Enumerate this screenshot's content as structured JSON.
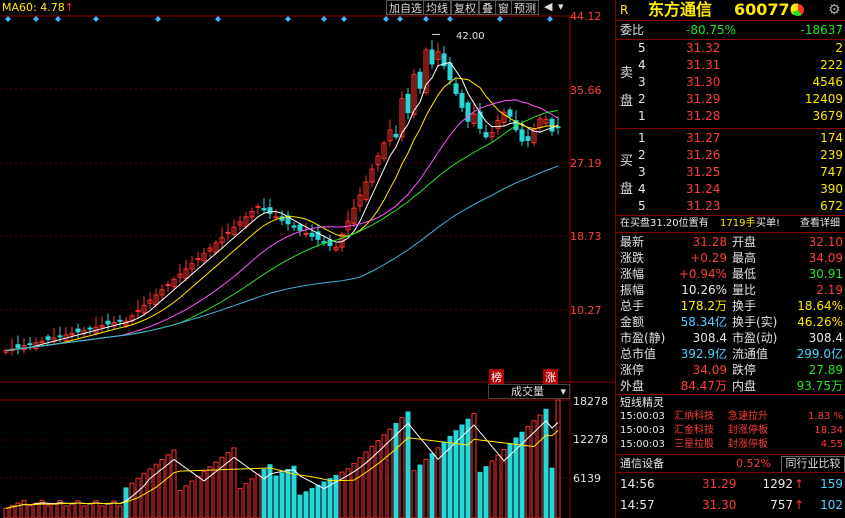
{
  "chart": {
    "ma60_label": "MA60: 4.78",
    "ma60_arrow": "↑",
    "toolbar": [
      "加自选",
      "均线",
      "复权",
      "叠",
      "窗",
      "预测"
    ],
    "price_ticks": [
      "44.12",
      "35.66",
      "27.19",
      "18.73",
      "10.27"
    ],
    "peak_label": "42.00",
    "vol_ticks": [
      "18278",
      "12278",
      "6139"
    ],
    "volume_label": "成交量",
    "tag_left": "榜",
    "tag_right": "涨",
    "colors": {
      "up": "#ff3030",
      "down": "#27d7d7",
      "ma5": "#ffffff",
      "ma10": "#ffea00",
      "ma20": "#ff55ff",
      "ma30": "#27e327",
      "ma60": "#3fb5d9"
    }
  },
  "quote": {
    "logo": "R",
    "name": "东方通信",
    "code": "600776",
    "weibi_label": "委比",
    "weibi_pct": "-80.75%",
    "weibi_val": "-18637",
    "sell_label": [
      "卖",
      "盘"
    ],
    "buy_label": [
      "买",
      "盘"
    ],
    "sell": [
      {
        "n": "5",
        "price": "31.32",
        "vol": "2"
      },
      {
        "n": "4",
        "price": "31.31",
        "vol": "222"
      },
      {
        "n": "3",
        "price": "31.30",
        "vol": "4546"
      },
      {
        "n": "2",
        "price": "31.29",
        "vol": "12409"
      },
      {
        "n": "1",
        "price": "31.28",
        "vol": "3679"
      }
    ],
    "buy": [
      {
        "n": "1",
        "price": "31.27",
        "vol": "174"
      },
      {
        "n": "2",
        "price": "31.26",
        "vol": "239"
      },
      {
        "n": "3",
        "price": "31.25",
        "vol": "747"
      },
      {
        "n": "4",
        "price": "31.24",
        "vol": "390"
      },
      {
        "n": "5",
        "price": "31.23",
        "vol": "672"
      }
    ],
    "notice_pre": "在买盘31.20位置有",
    "notice_vol": "1719手",
    "notice_post": "买单!",
    "notice_link": "查看详细",
    "stats": [
      {
        "l1": "最新",
        "v1": "31.28",
        "c1": "red",
        "l2": "开盘",
        "v2": "32.10",
        "c2": "red"
      },
      {
        "l1": "涨跌",
        "v1": "+0.29",
        "c1": "red",
        "l2": "最高",
        "v2": "34.09",
        "c2": "red"
      },
      {
        "l1": "涨幅",
        "v1": "+0.94%",
        "c1": "red",
        "l2": "最低",
        "v2": "30.91",
        "c2": "green"
      },
      {
        "l1": "振幅",
        "v1": "10.26%",
        "c1": "white",
        "l2": "量比",
        "v2": "2.19",
        "c2": "red"
      },
      {
        "l1": "总手",
        "v1": "178.2万",
        "c1": "yellow",
        "l2": "换手",
        "v2": "18.64%",
        "c2": "yellow"
      },
      {
        "l1": "金额",
        "v1": "58.34亿",
        "c1": "cyan",
        "l2": "换手(实)",
        "v2": "46.26%",
        "c2": "yellow"
      },
      {
        "l1": "市盈(静)",
        "v1": "308.4",
        "c1": "white",
        "l2": "市盈(动)",
        "v2": "308.4",
        "c2": "white"
      },
      {
        "l1": "总市值",
        "v1": "392.9亿",
        "c1": "cyan",
        "l2": "流通值",
        "v2": "299.0亿",
        "c2": "cyan"
      },
      {
        "l1": "涨停",
        "v1": "34.09",
        "c1": "red",
        "l2": "跌停",
        "v2": "27.89",
        "c2": "green"
      },
      {
        "l1": "外盘",
        "v1": "84.47万",
        "c1": "red",
        "l2": "内盘",
        "v2": "93.75万",
        "c2": "green"
      }
    ],
    "short_title": "短线精灵",
    "short_items": [
      {
        "time": "15:00:03",
        "name": "汇纳科技",
        "event": "急速拉升",
        "val": "1.83 %"
      },
      {
        "time": "15:00:03",
        "name": "汇金科技",
        "event": "封涨停板",
        "val": "18.34"
      },
      {
        "time": "15:00:03",
        "name": "三星拉股",
        "event": "封涨停板",
        "val": "4.55"
      }
    ],
    "sector_name": "通信设备",
    "sector_pct": "0.52%",
    "sector_btn": "同行业比较",
    "ticks": [
      {
        "time": "14:56",
        "price": "31.29",
        "vol": "1292",
        "arrow": "↑",
        "n": "159"
      },
      {
        "time": "14:57",
        "price": "31.30",
        "vol": "757",
        "arrow": "↑",
        "n": "102"
      }
    ]
  },
  "chart_data": {
    "type": "candlestick",
    "price_axis": {
      "ticks": [
        44.12,
        35.66,
        27.19,
        18.73,
        10.27
      ]
    },
    "volume_axis": {
      "ticks": [
        18278,
        12278,
        6139
      ]
    },
    "peak_high": 42.0,
    "last_close": 31.28,
    "ma60": 4.78
  }
}
